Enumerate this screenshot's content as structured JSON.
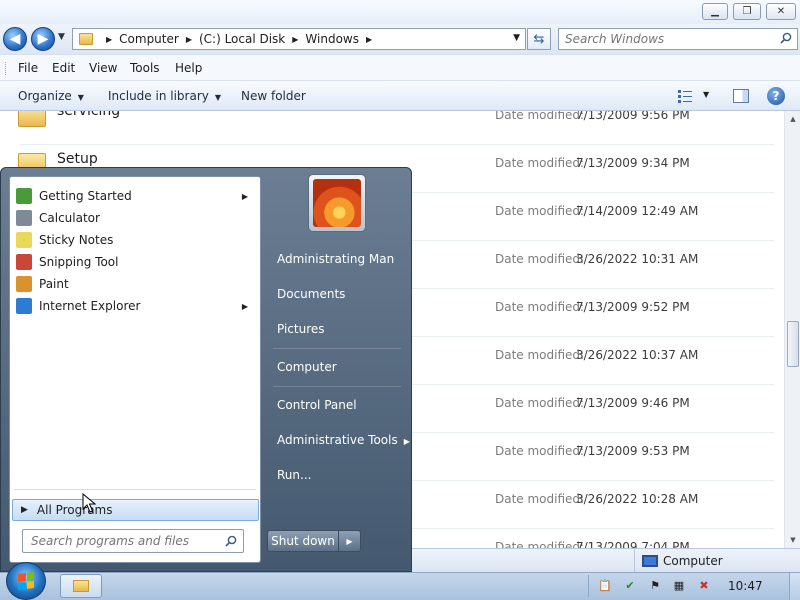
{
  "address": {
    "crumbs": [
      "Computer",
      "(C:) Local Disk",
      "Windows"
    ],
    "search_placeholder": "Search Windows"
  },
  "menu": [
    "File",
    "Edit",
    "View",
    "Tools",
    "Help"
  ],
  "commands": {
    "organize": "Organize",
    "include": "Include in library",
    "new_folder": "New folder"
  },
  "files": [
    {
      "name": "servicing",
      "label": "Date modified:",
      "date": "7/13/2009 9:56 PM"
    },
    {
      "name": "Setup",
      "label": "Date modified:",
      "date": "7/13/2009 9:34 PM"
    },
    {
      "name": "",
      "label": "Date modified:",
      "date": "7/14/2009 12:49 AM"
    },
    {
      "name": "",
      "label": "Date modified:",
      "date": "3/26/2022 10:31 AM"
    },
    {
      "name": "",
      "label": "Date modified:",
      "date": "7/13/2009 9:52 PM"
    },
    {
      "name": "",
      "label": "Date modified:",
      "date": "3/26/2022 10:37 AM"
    },
    {
      "name": "",
      "label": "Date modified:",
      "date": "7/13/2009 9:46 PM"
    },
    {
      "name": "",
      "label": "Date modified:",
      "date": "7/13/2009 9:53 PM"
    },
    {
      "name": "",
      "label": "Date modified:",
      "date": "3/26/2022 10:28 AM"
    },
    {
      "name": "",
      "label": "Date modified:",
      "date": "7/13/2009 7:04 PM"
    }
  ],
  "status": {
    "zone": "Computer"
  },
  "start_menu": {
    "programs": [
      {
        "label": "Getting Started",
        "icon": "getting-started-icon",
        "submenu": true,
        "color": "#4a9a3c"
      },
      {
        "label": "Calculator",
        "icon": "calculator-icon",
        "submenu": false,
        "color": "#7d8a98"
      },
      {
        "label": "Sticky Notes",
        "icon": "sticky-notes-icon",
        "submenu": false,
        "color": "#e9d75a"
      },
      {
        "label": "Snipping Tool",
        "icon": "snipping-tool-icon",
        "submenu": false,
        "color": "#c9473a"
      },
      {
        "label": "Paint",
        "icon": "paint-icon",
        "submenu": false,
        "color": "#d9922e"
      },
      {
        "label": "Internet Explorer",
        "icon": "internet-explorer-icon",
        "submenu": true,
        "color": "#2d7bd3"
      }
    ],
    "all_programs": "All Programs",
    "search_placeholder": "Search programs and files",
    "right_links": {
      "user": "Administrating Man",
      "documents": "Documents",
      "pictures": "Pictures",
      "computer": "Computer",
      "control_panel": "Control Panel",
      "admin_tools": "Administrative Tools",
      "run": "Run..."
    },
    "shutdown": "Shut down"
  },
  "taskbar": {
    "clock": "10:47"
  }
}
